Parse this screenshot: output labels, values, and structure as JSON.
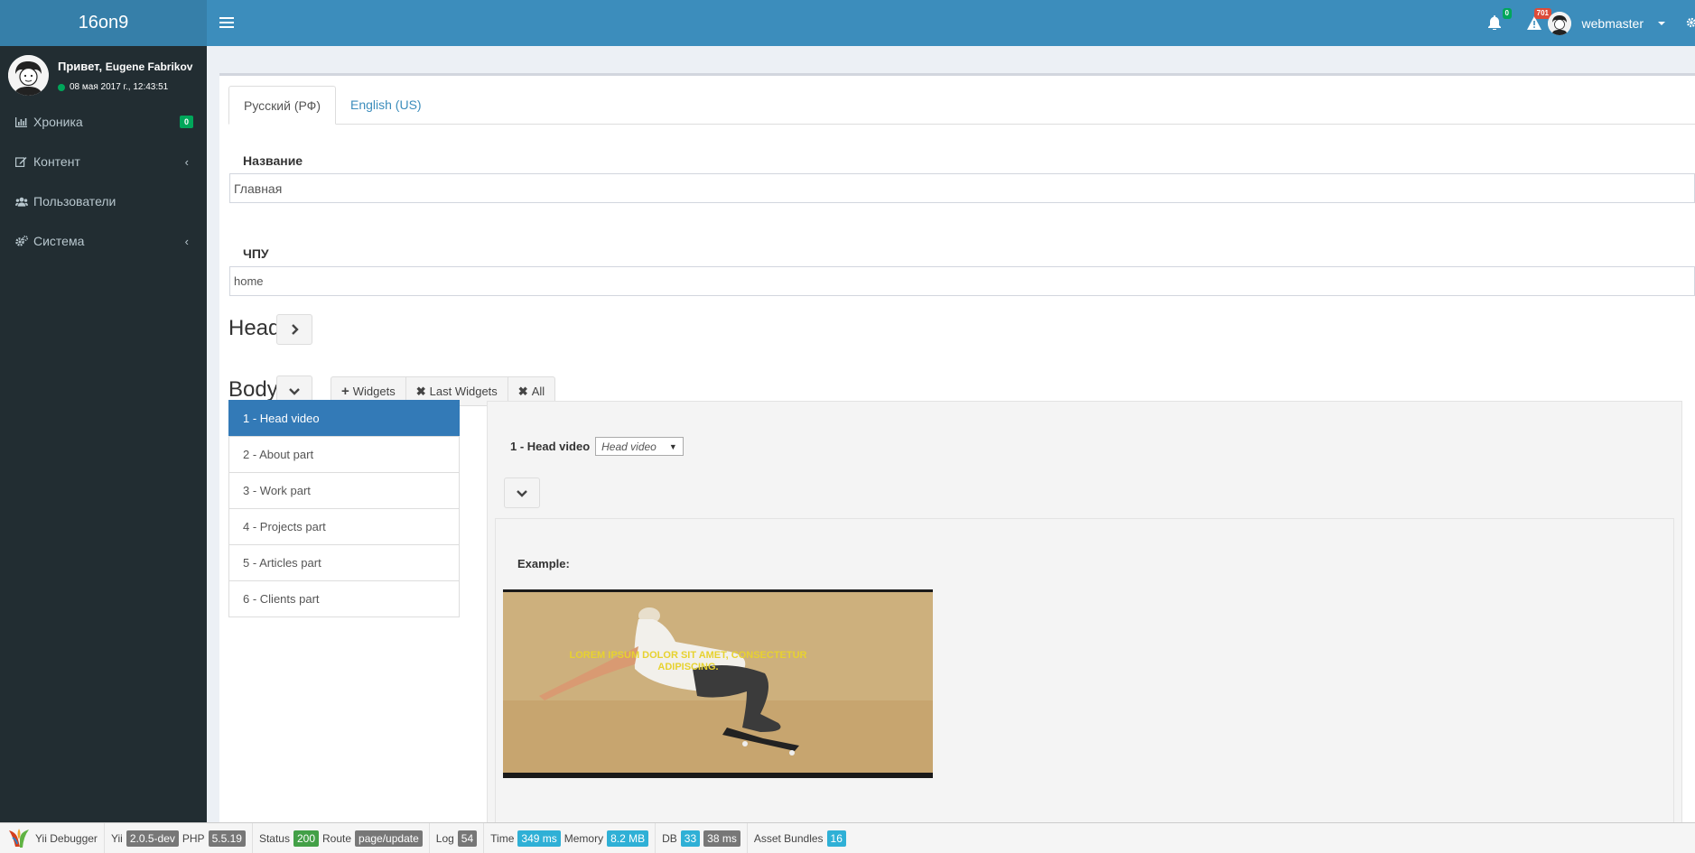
{
  "app": {
    "logo": "16on9"
  },
  "header": {
    "notifications_count": "0",
    "alerts_count": "701",
    "username": "webmaster"
  },
  "sidebar": {
    "greeting_prefix": "Привет,",
    "greeting_name": "Eugene Fabrikov",
    "datetime": "08 мая 2017 г., 12:43:51",
    "items": [
      {
        "label": "Хроника",
        "badge": "0"
      },
      {
        "label": "Контент"
      },
      {
        "label": "Пользователи"
      },
      {
        "label": "Система"
      }
    ]
  },
  "tabs": [
    {
      "label": "Русский (РФ)"
    },
    {
      "label": "English (US)"
    }
  ],
  "form": {
    "name_label": "Название",
    "name_value": "Главная",
    "slug_label": "ЧПУ",
    "slug_value": "home"
  },
  "head_title": "Head",
  "body_title": "Body",
  "body_buttons": {
    "widgets": "Widgets",
    "last_widgets": "Last Widgets",
    "all": "All"
  },
  "widgets_list": [
    "1 - Head video",
    "2 - About part",
    "3 - Work part",
    "4 - Projects part",
    "5 - Articles part",
    "6 - Clients part"
  ],
  "widget_panel": {
    "title": "1 - Head video",
    "select_value": "Head video",
    "example_label": "Example:",
    "video_overlay_text": "LOREM IPSUM DOLOR SIT AMET, CONSECTETUR ADIPISCING."
  },
  "debugbar": {
    "title": "Yii Debugger",
    "yii_label": "Yii",
    "yii_version": "2.0.5-dev",
    "php_label": "PHP",
    "php_version": "5.5.19",
    "status_label": "Status",
    "status_value": "200",
    "route_label": "Route",
    "route_value": "page/update",
    "log_label": "Log",
    "log_value": "54",
    "time_label": "Time",
    "time_value": "349 ms",
    "memory_label": "Memory",
    "memory_value": "8.2 MB",
    "db_label": "DB",
    "db_queries": "33",
    "db_time": "38 ms",
    "assets_label": "Asset Bundles",
    "assets_value": "16"
  },
  "colors": {
    "header": "#3c8dbc",
    "logo_bg": "#367fa9",
    "sidebar": "#222d32",
    "active_item": "#337ab7",
    "badge_green": "#00a65a",
    "badge_red": "#dd4b39"
  }
}
